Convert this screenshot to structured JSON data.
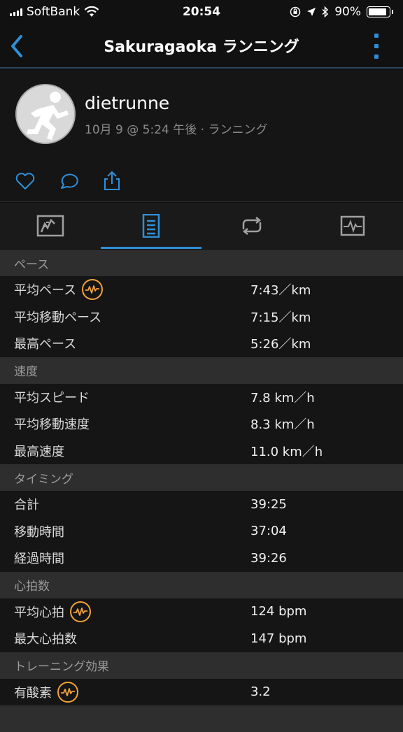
{
  "status": {
    "carrier": "SoftBank",
    "time": "20:54",
    "battery": "90%",
    "battery_level": 0.9
  },
  "nav": {
    "title": "Sakuragaoka ランニング"
  },
  "profile": {
    "name": "dietrunne",
    "subtitle": "10月 9 @ 5:24 午後 · ランニング"
  },
  "colors": {
    "accent": "#2f8fd8",
    "badge": "#f2a23a",
    "section_bg": "#2e2e2e",
    "row_bg": "#151515"
  },
  "sections": {
    "pace": {
      "title": "ペース",
      "avg_pace_label": "平均ペース",
      "avg_pace_value": "7:43／km",
      "avg_moving_pace_label": "平均移動ペース",
      "avg_moving_pace_value": "7:15／km",
      "best_pace_label": "最高ペース",
      "best_pace_value": "5:26／km"
    },
    "speed": {
      "title": "速度",
      "avg_speed_label": "平均スピード",
      "avg_speed_value": "7.8 km／h",
      "avg_moving_speed_label": "平均移動速度",
      "avg_moving_speed_value": "8.3 km／h",
      "max_speed_label": "最高速度",
      "max_speed_value": "11.0 km／h"
    },
    "timing": {
      "title": "タイミング",
      "total_label": "合計",
      "total_value": "39:25",
      "moving_label": "移動時間",
      "moving_value": "37:04",
      "elapsed_label": "経過時間",
      "elapsed_value": "39:26"
    },
    "heart": {
      "title": "心拍数",
      "avg_hr_label": "平均心拍",
      "avg_hr_value": "124 bpm",
      "max_hr_label": "最大心拍数",
      "max_hr_value": "147 bpm"
    },
    "training": {
      "title": "トレーニング効果",
      "aerobic_label": "有酸素",
      "aerobic_value": "3.2"
    }
  }
}
